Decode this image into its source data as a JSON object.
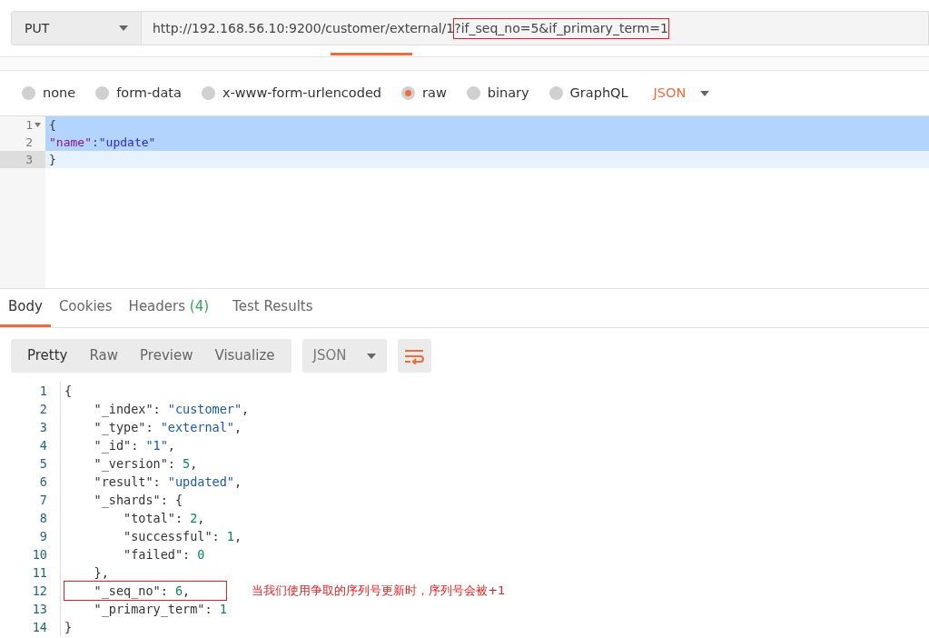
{
  "request": {
    "method": "PUT",
    "url_base": "http://192.168.56.10:9200/customer/external/1",
    "url_highlighted": "?if_seq_no=5&if_primary_term=1"
  },
  "body_types": [
    {
      "label": "none",
      "selected": false
    },
    {
      "label": "form-data",
      "selected": false
    },
    {
      "label": "x-www-form-urlencoded",
      "selected": false
    },
    {
      "label": "raw",
      "selected": true
    },
    {
      "label": "binary",
      "selected": false
    },
    {
      "label": "GraphQL",
      "selected": false
    }
  ],
  "raw_format": "JSON",
  "request_editor": {
    "lines": [
      {
        "number": "1",
        "text": "{",
        "selected": true,
        "foldable": true
      },
      {
        "number": "2",
        "text": "\"name\":\"update\"",
        "selected": true,
        "foldable": false
      },
      {
        "number": "3",
        "text": "}",
        "selected": false,
        "foldable": false
      }
    ]
  },
  "response_tabs": [
    {
      "label": "Body",
      "selected": true
    },
    {
      "label": "Cookies",
      "selected": false
    },
    {
      "label": "Headers",
      "count": "(4)",
      "selected": false
    },
    {
      "label": "Test Results",
      "selected": false
    }
  ],
  "view_modes": [
    {
      "label": "Pretty",
      "selected": true
    },
    {
      "label": "Raw",
      "selected": false
    },
    {
      "label": "Preview",
      "selected": false
    },
    {
      "label": "Visualize",
      "selected": false
    }
  ],
  "response_format": "JSON",
  "response_body": {
    "lines": [
      {
        "number": "1",
        "text": "{",
        "boxed": false
      },
      {
        "number": "2",
        "text": "    \"_index\": \"customer\",",
        "boxed": false
      },
      {
        "number": "3",
        "text": "    \"_type\": \"external\",",
        "boxed": false
      },
      {
        "number": "4",
        "text": "    \"_id\": \"1\",",
        "boxed": false
      },
      {
        "number": "5",
        "text": "    \"_version\": 5,",
        "boxed": false
      },
      {
        "number": "6",
        "text": "    \"result\": \"updated\",",
        "boxed": false
      },
      {
        "number": "7",
        "text": "    \"_shards\": {",
        "boxed": false
      },
      {
        "number": "8",
        "text": "        \"total\": 2,",
        "boxed": false
      },
      {
        "number": "9",
        "text": "        \"successful\": 1,",
        "boxed": false
      },
      {
        "number": "10",
        "text": "        \"failed\": 0",
        "boxed": false
      },
      {
        "number": "11",
        "text": "    },",
        "boxed": false
      },
      {
        "number": "12",
        "text": "    \"_seq_no\": 6,",
        "boxed": true,
        "note": "当我们使用争取的序列号更新时，序列号会被+1"
      },
      {
        "number": "13",
        "text": "    \"_primary_term\": 1",
        "boxed": false
      },
      {
        "number": "14",
        "text": "}",
        "boxed": false
      }
    ]
  }
}
